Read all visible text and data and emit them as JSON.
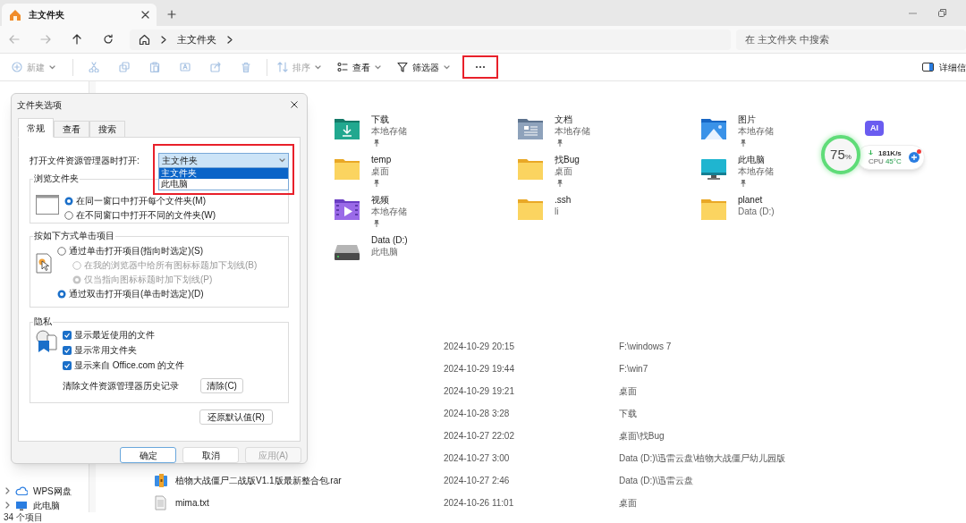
{
  "tabs": [
    {
      "label": "主文件夹",
      "selected": true
    }
  ],
  "nav": [
    {
      "kind": "back",
      "disabled": true
    },
    {
      "kind": "forward",
      "disabled": true
    },
    {
      "kind": "up",
      "disabled": false
    },
    {
      "kind": "refresh",
      "disabled": false
    }
  ],
  "breadcrumb": [
    "主文件夹"
  ],
  "search": {
    "placeholder": "在 主文件夹 中搜索"
  },
  "toolbar": [
    {
      "kind": "new",
      "label": "新建",
      "disabled": true,
      "dropdown": true
    },
    {
      "kind": "separator"
    },
    {
      "kind": "cut",
      "disabled": true
    },
    {
      "kind": "copy",
      "disabled": true
    },
    {
      "kind": "paste",
      "disabled": true
    },
    {
      "kind": "rename",
      "disabled": true
    },
    {
      "kind": "share",
      "disabled": true
    },
    {
      "kind": "delete",
      "disabled": true
    },
    {
      "kind": "separator"
    },
    {
      "kind": "sort",
      "label": "排序",
      "disabled": true,
      "dropdown": true
    },
    {
      "kind": "view",
      "label": "查看",
      "disabled": false,
      "dropdown": true
    },
    {
      "kind": "filter",
      "label": "筛选器",
      "disabled": false,
      "dropdown": true
    },
    {
      "kind": "more",
      "disabled": false
    }
  ],
  "details_pane": {
    "label": "详细信"
  },
  "quick_access": [
    {
      "name": "下载",
      "location": "本地存储",
      "pinned": true,
      "kind": "download"
    },
    {
      "name": "文档",
      "location": "本地存储",
      "pinned": true,
      "kind": "documents"
    },
    {
      "name": "图片",
      "location": "本地存储",
      "pinned": true,
      "kind": "pictures"
    },
    {
      "name": "temp",
      "location": "桌面",
      "pinned": true,
      "kind": "folder"
    },
    {
      "name": "找Bug",
      "location": "桌面",
      "pinned": true,
      "kind": "folder"
    },
    {
      "name": "此电脑",
      "location": "本地存储",
      "pinned": true,
      "kind": "pc"
    },
    {
      "name": "视频",
      "location": "本地存储",
      "pinned": true,
      "kind": "video"
    },
    {
      "name": ".ssh",
      "location": "li",
      "pinned": false,
      "kind": "folder"
    },
    {
      "name": "planet",
      "location": "Data (D:)",
      "pinned": false,
      "kind": "folder"
    },
    {
      "name": "Data (D:)",
      "location": "此电脑",
      "pinned": false,
      "kind": "drive"
    }
  ],
  "recent": [
    {
      "date": "2024-10-29 20:15",
      "location": "F:\\windows 7"
    },
    {
      "date": "2024-10-29 19:44",
      "location": "F:\\win7"
    },
    {
      "date": "2024-10-29 19:21",
      "location": "桌面"
    },
    {
      "date": "2024-10-28 3:28",
      "location": "下载"
    },
    {
      "date": "2024-10-27 22:02",
      "location": "桌面\\找Bug"
    },
    {
      "date": "2024-10-27 3:00",
      "location": "Data (D:)\\迅雷云盘\\植物大战僵尸幼儿园版"
    },
    {
      "name": "植物大战僵尸二战版V1.1版最新整合包.rar",
      "kind": "archive",
      "date": "2024-10-27 2:46",
      "location": "Data (D:)\\迅雷云盘"
    },
    {
      "name": "mima.txt",
      "kind": "text",
      "date": "2024-10-26 11:01",
      "location": "桌面"
    }
  ],
  "sidebar": [
    {
      "label": "WPS网盘",
      "kind": "cloud"
    },
    {
      "label": "此电脑",
      "kind": "pc"
    }
  ],
  "status_bar": {
    "count": "34 个项目"
  },
  "widget": {
    "ai": "AI",
    "percent": "75",
    "unit": "%",
    "speed": "181K/s",
    "cpu_label": "CPU",
    "cpu_temp": "45°C"
  },
  "dialog": {
    "title": "文件夹选项",
    "tabs": [
      {
        "label": "常规",
        "selected": true
      },
      {
        "label": "查看",
        "selected": false
      },
      {
        "label": "搜索",
        "selected": false
      }
    ],
    "open_with": {
      "label": "打开文件资源管理器时打开:",
      "value": "主文件夹",
      "expanded": true,
      "options": [
        {
          "label": "主文件夹",
          "selected": true
        },
        {
          "label": "此电脑",
          "selected": false
        }
      ]
    },
    "browse": {
      "title": "浏览文件夹",
      "options": [
        {
          "label": "在同一窗口中打开每个文件夹(M)",
          "selected": true
        },
        {
          "label": "在不同窗口中打开不同的文件夹(W)",
          "selected": false
        }
      ]
    },
    "click": {
      "title": "按如下方式单击项目",
      "options": [
        {
          "label": "通过单击打开项目(指向时选定)(S)",
          "selected": false,
          "disabled": false,
          "children": [
            {
              "label": "在我的浏览器中给所有图标标题加下划线(B)",
              "selected": false,
              "disabled": true
            },
            {
              "label": "仅当指向图标标题时加下划线(P)",
              "selected": true,
              "disabled": true
            }
          ]
        },
        {
          "label": "通过双击打开项目(单击时选定)(D)",
          "selected": true,
          "disabled": false
        }
      ]
    },
    "privacy": {
      "title": "隐私",
      "options": [
        {
          "label": "显示最近使用的文件",
          "checked": true
        },
        {
          "label": "显示常用文件夹",
          "checked": true
        },
        {
          "label": "显示来自 Office.com 的文件",
          "checked": true
        }
      ],
      "clear_label": "清除文件资源管理器历史记录",
      "clear_button": "清除(C)"
    },
    "restore_button": "还原默认值(R)",
    "buttons": [
      {
        "label": "确定",
        "kind": "primary",
        "disabled": false
      },
      {
        "label": "取消",
        "kind": "normal",
        "disabled": false
      },
      {
        "label": "应用(A)",
        "kind": "normal",
        "disabled": true
      }
    ]
  }
}
